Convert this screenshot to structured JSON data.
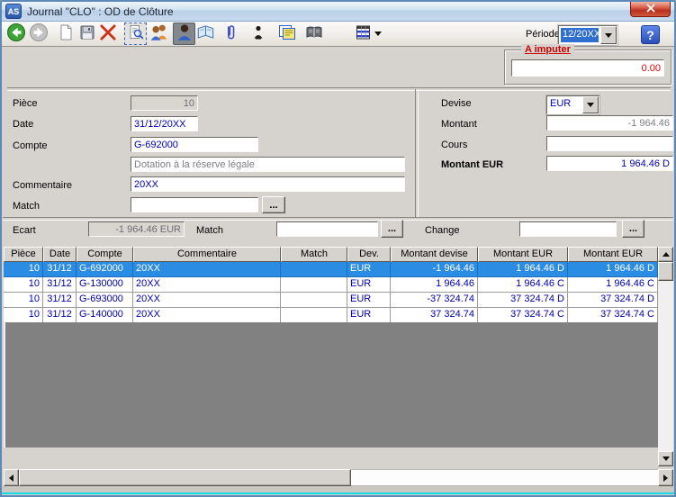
{
  "window": {
    "title": "Journal \"CLO\" : OD de Clôture"
  },
  "toolbar": {
    "icons": [
      "back-icon",
      "forward-icon",
      "new-document-icon",
      "save-icon",
      "delete-icon",
      "search-icon",
      "users-icon",
      "user-icon",
      "map-book-icon",
      "attachment-icon",
      "person-icon",
      "form-window-icon",
      "open-book-icon",
      "grid-menu-icon"
    ],
    "periode_label": "Période",
    "periode_value": "12/20XX",
    "help_label": "?"
  },
  "a_imputer": {
    "label": "A imputer",
    "value": "0.00"
  },
  "form": {
    "left": {
      "piece_label": "Pièce",
      "piece_value": "10",
      "date_label": "Date",
      "date_value": "31/12/20XX",
      "compte_label": "Compte",
      "compte_value": "G-692000",
      "compte_desc": "Dotation à la réserve légale",
      "commentaire_label": "Commentaire",
      "commentaire_value": "20XX",
      "match_label": "Match",
      "match_value": "",
      "browse_label": "..."
    },
    "right": {
      "devise_label": "Devise",
      "devise_value": "EUR",
      "montant_label": "Montant",
      "montant_value": "-1 964.46",
      "cours_label": "Cours",
      "cours_value": "",
      "montant_eur_label": "Montant EUR",
      "montant_eur_value": "1 964.46 D"
    }
  },
  "ecart_row": {
    "ecart_label": "Ecart",
    "ecart_value": "-1 964.46 EUR",
    "match_label": "Match",
    "match_value": "",
    "change_label": "Change",
    "change_value": "",
    "browse_label": "..."
  },
  "table": {
    "columns": [
      "Pièce",
      "Date",
      "Compte",
      "Commentaire",
      "Match",
      "Dev.",
      "Montant devise",
      "Montant EUR",
      "Montant EUR"
    ],
    "rows": [
      {
        "selected": true,
        "cells": [
          "10",
          "31/12",
          "G-692000",
          "20XX",
          "",
          "EUR",
          "-1 964.46",
          "1 964.46 D",
          "1 964.46 D"
        ]
      },
      {
        "selected": false,
        "cells": [
          "10",
          "31/12",
          "G-130000",
          "20XX",
          "",
          "EUR",
          "1 964.46",
          "1 964.46 C",
          "1 964.46 C"
        ]
      },
      {
        "selected": false,
        "cells": [
          "10",
          "31/12",
          "G-693000",
          "20XX",
          "",
          "EUR",
          "-37 324.74",
          "37 324.74 D",
          "37 324.74 D"
        ]
      },
      {
        "selected": false,
        "cells": [
          "10",
          "31/12",
          "G-140000",
          "20XX",
          "",
          "EUR",
          "37 324.74",
          "37 324.74 C",
          "37 324.74 C"
        ]
      }
    ]
  },
  "colors": {
    "selection_blue": "#2b8ce4",
    "data_blue": "#0000b0",
    "alert_red": "#cc0000",
    "window_gray": "#d6d3ce",
    "empty_area_gray": "#818181",
    "bottom_cyan": "#12dce8"
  }
}
